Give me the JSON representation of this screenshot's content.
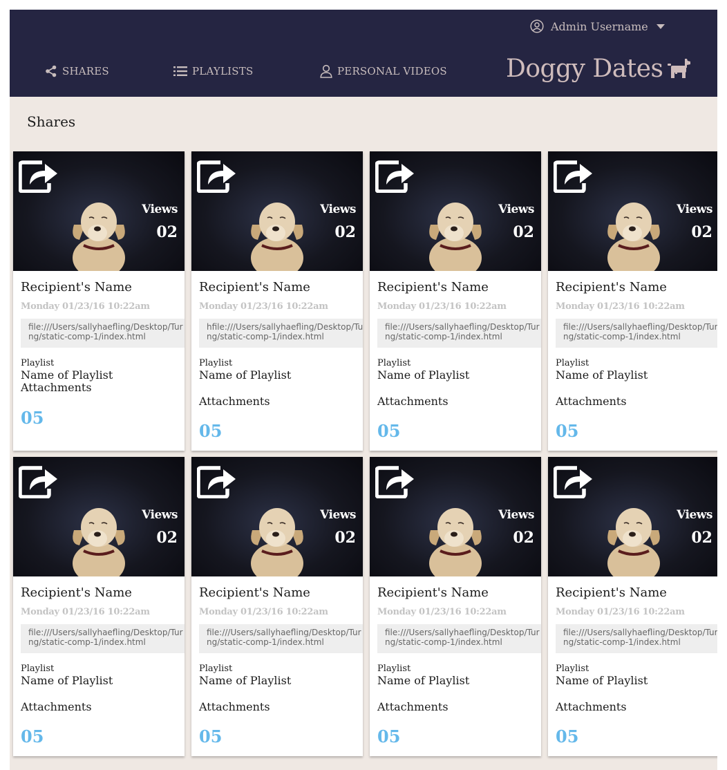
{
  "header": {
    "username": "Admin Username",
    "brand": "Doggy Dates",
    "nav": [
      {
        "label": "SHARES",
        "icon": "share-nodes-icon"
      },
      {
        "label": "PLAYLISTS",
        "icon": "list-icon"
      },
      {
        "label": "PERSONAL VIDEOS",
        "icon": "user-outline-icon"
      }
    ]
  },
  "section": {
    "title": "Shares"
  },
  "cards": [
    {
      "views_label": "Views",
      "views": "02",
      "recipient": "Recipient's Name",
      "date": "Monday 01/23/16 10:22am",
      "link_line1": "file:///Users/sallyhaefling/Desktop/Tur",
      "link_line2": "ng/static-comp-1/index.html",
      "playlist_label": "Playlist",
      "playlist_name": "Name of Playlist",
      "attachments_label": "Attachments",
      "attachments": "05"
    },
    {
      "views_label": "Views",
      "views": "02",
      "recipient": "Recipient's Name",
      "date": "Monday 01/23/16 10:22am",
      "link_line1": "hfile:///Users/sallyhaefling/Desktop/Tur",
      "link_line2": "ng/static-comp-1/index.html",
      "playlist_label": "Playlist",
      "playlist_name": "Name of Playlist",
      "attachments_label": "Attachments",
      "attachments": "05"
    },
    {
      "views_label": "Views",
      "views": "02",
      "recipient": "Recipient's Name",
      "date": "Monday 01/23/16 10:22am",
      "link_line1": "file:///Users/sallyhaefling/Desktop/Tur",
      "link_line2": "ng/static-comp-1/index.html",
      "playlist_label": "Playlist",
      "playlist_name": "Name of Playlist",
      "attachments_label": "Attachments",
      "attachments": "05"
    },
    {
      "views_label": "Views",
      "views": "02",
      "recipient": "Recipient's Name",
      "date": "Monday 01/23/16 10:22am",
      "link_line1": "file:///Users/sallyhaefling/Desktop/Tur",
      "link_line2": "ng/static-comp-1/index.html",
      "playlist_label": "Playlist",
      "playlist_name": "Name of Playlist",
      "attachments_label": "Attachments",
      "attachments": "05"
    },
    {
      "views_label": "Views",
      "views": "02",
      "recipient": "Recipient's Name",
      "date": "Monday 01/23/16 10:22am",
      "link_line1": "file:///Users/sallyhaefling/Desktop/Tur",
      "link_line2": "ng/static-comp-1/index.html",
      "playlist_label": "Playlist",
      "playlist_name": "Name of Playlist",
      "attachments_label": "Attachments",
      "attachments": "05"
    },
    {
      "views_label": "Views",
      "views": "02",
      "recipient": "Recipient's Name",
      "date": "Monday 01/23/16 10:22am",
      "link_line1": "file:///Users/sallyhaefling/Desktop/Tur",
      "link_line2": "ng/static-comp-1/index.html",
      "playlist_label": "Playlist",
      "playlist_name": "Name of Playlist",
      "attachments_label": "Attachments",
      "attachments": "05"
    },
    {
      "views_label": "Views",
      "views": "02",
      "recipient": "Recipient's Name",
      "date": "Monday 01/23/16 10:22am",
      "link_line1": "file:///Users/sallyhaefling/Desktop/Tur",
      "link_line2": "ng/static-comp-1/index.html",
      "playlist_label": "Playlist",
      "playlist_name": "Name of Playlist",
      "attachments_label": "Attachments",
      "attachments": "05"
    },
    {
      "views_label": "Views",
      "views": "02",
      "recipient": "Recipient's Name",
      "date": "Monday 01/23/16 10:22am",
      "link_line1": "file:///Users/sallyhaefling/Desktop/Tur",
      "link_line2": "ng/static-comp-1/index.html",
      "playlist_label": "Playlist",
      "playlist_name": "Name of Playlist",
      "attachments_label": "Attachments",
      "attachments": "05"
    }
  ],
  "colors": {
    "topbar": "#252542",
    "nav_text": "#c8bdbd",
    "content_bg": "#efe8e3",
    "attachments_accent": "#64b8ea"
  }
}
